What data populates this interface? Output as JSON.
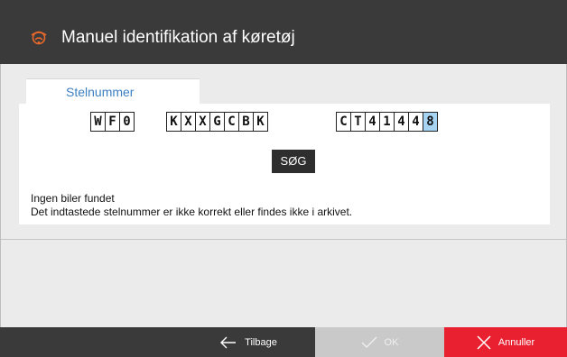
{
  "header": {
    "title": "Manuel identifikation af køretøj",
    "logo_icon": "car-badge-icon"
  },
  "tab": {
    "label": "Stelnummer"
  },
  "vin": {
    "groups": [
      [
        "W",
        "F",
        "0"
      ],
      [
        "K",
        "X",
        "X",
        "G",
        "C",
        "B",
        "K"
      ],
      [
        "C",
        "T",
        "4",
        "1",
        "4",
        "4",
        "8"
      ]
    ],
    "selected_char": "8"
  },
  "search": {
    "label": "SØG"
  },
  "messages": {
    "line1": "Ingen biler fundet",
    "line2": "Det indtastede stelnummer er ikke korrekt eller findes ikke i arkivet."
  },
  "footer": {
    "back_label": "Tilbage",
    "ok_label": "OK",
    "cancel_label": "Annuller",
    "back_icon": "arrow-left-icon",
    "ok_icon": "checkmark-icon",
    "cancel_icon": "close-icon"
  },
  "colors": {
    "header_bg": "#3a3a3a",
    "accent_blue": "#3c7fc1",
    "selected_cell": "#a8d4f4",
    "cancel_red": "#e8202f",
    "ok_disabled": "#c9c9c9",
    "logo_orange": "#e8682b"
  }
}
